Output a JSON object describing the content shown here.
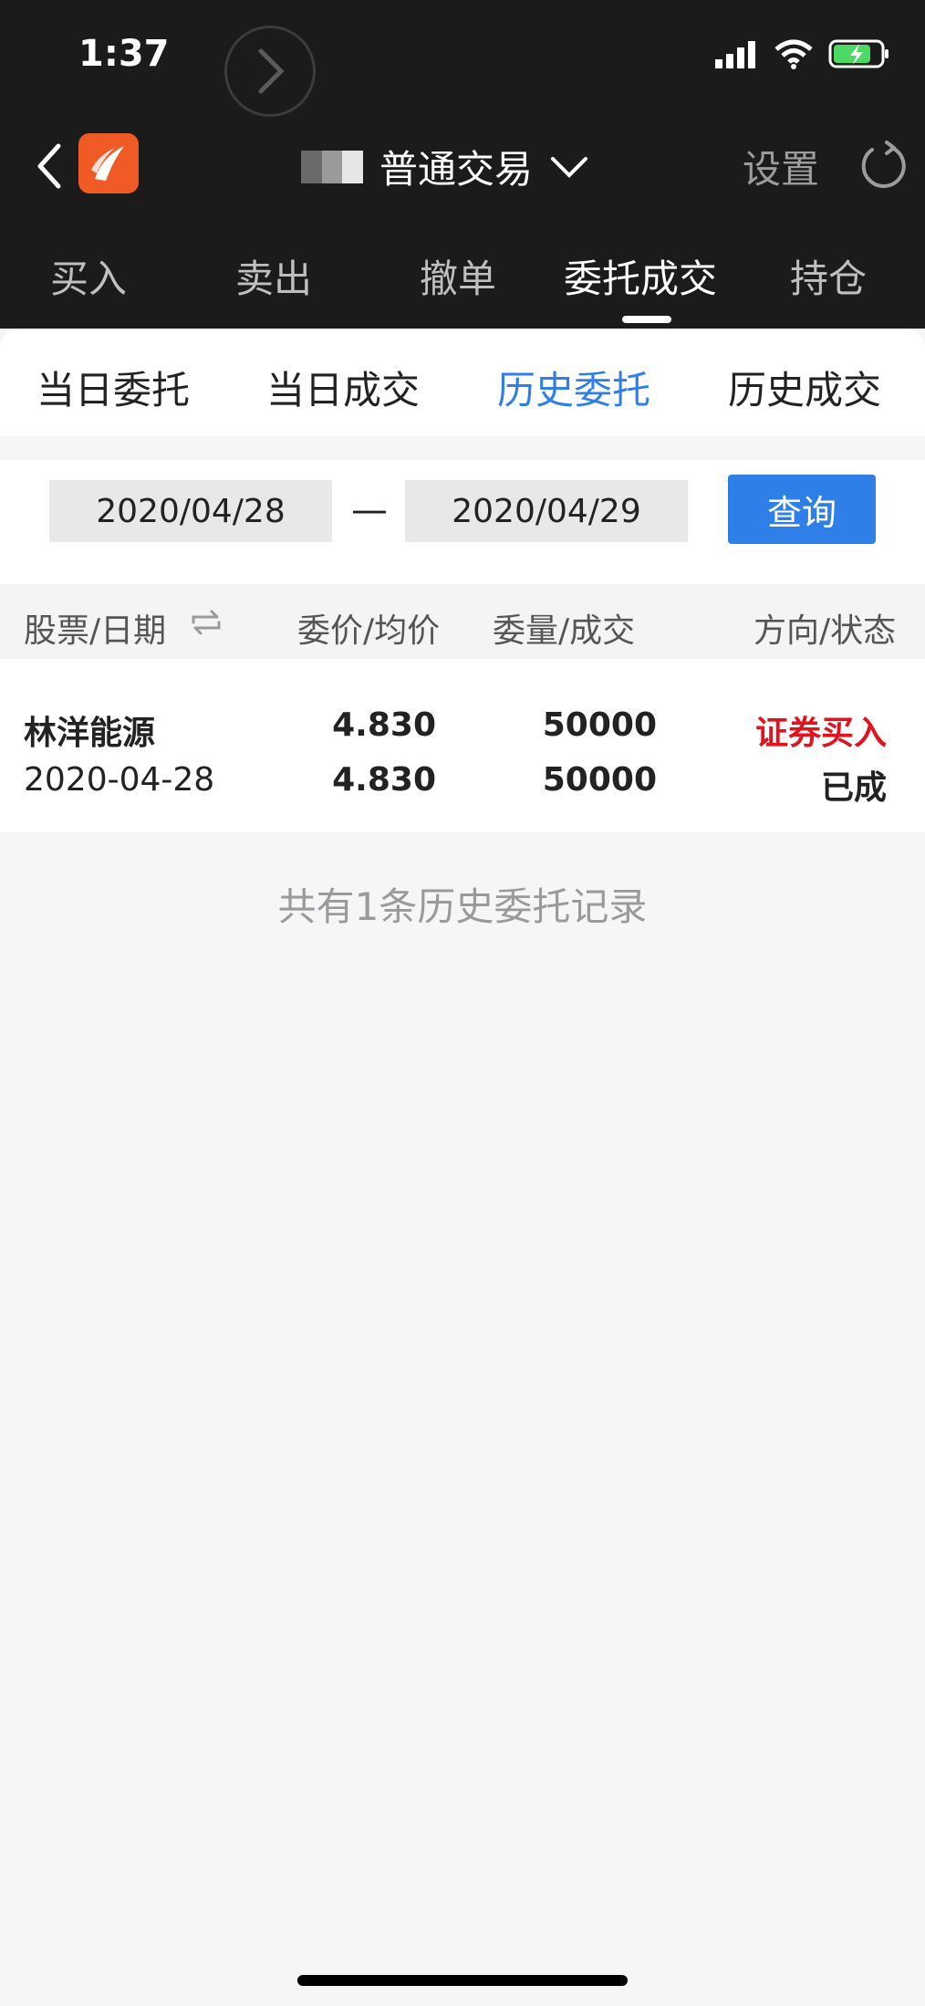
{
  "status_bar": {
    "time": "1:37"
  },
  "nav": {
    "title": "普通交易",
    "settings_label": "设置"
  },
  "top_tabs": [
    {
      "label": "买入"
    },
    {
      "label": "卖出"
    },
    {
      "label": "撤单"
    },
    {
      "label": "委托成交",
      "active": true
    },
    {
      "label": "持仓"
    }
  ],
  "sub_tabs": [
    {
      "label": "当日委托"
    },
    {
      "label": "当日成交"
    },
    {
      "label": "历史委托",
      "active": true
    },
    {
      "label": "历史成交"
    }
  ],
  "date_range": {
    "start": "2020/04/28",
    "separator": "—",
    "end": "2020/04/29",
    "query_label": "查询"
  },
  "table": {
    "headers": [
      "股票/日期",
      "委价/均价",
      "委量/成交",
      "方向/状态"
    ],
    "rows": [
      {
        "stock": "林洋能源",
        "date": "2020-04-28",
        "order_price": "4.830",
        "avg_price": "4.830",
        "order_qty": "50000",
        "filled_qty": "50000",
        "direction": "证券买入",
        "status": "已成"
      }
    ]
  },
  "summary_text": "共有1条历史委托记录",
  "colors": {
    "accent": "#2f7fe8",
    "buy_red": "#e0141e",
    "dark_bg": "#1b1b1c",
    "logo_orange": "#f05a24"
  }
}
